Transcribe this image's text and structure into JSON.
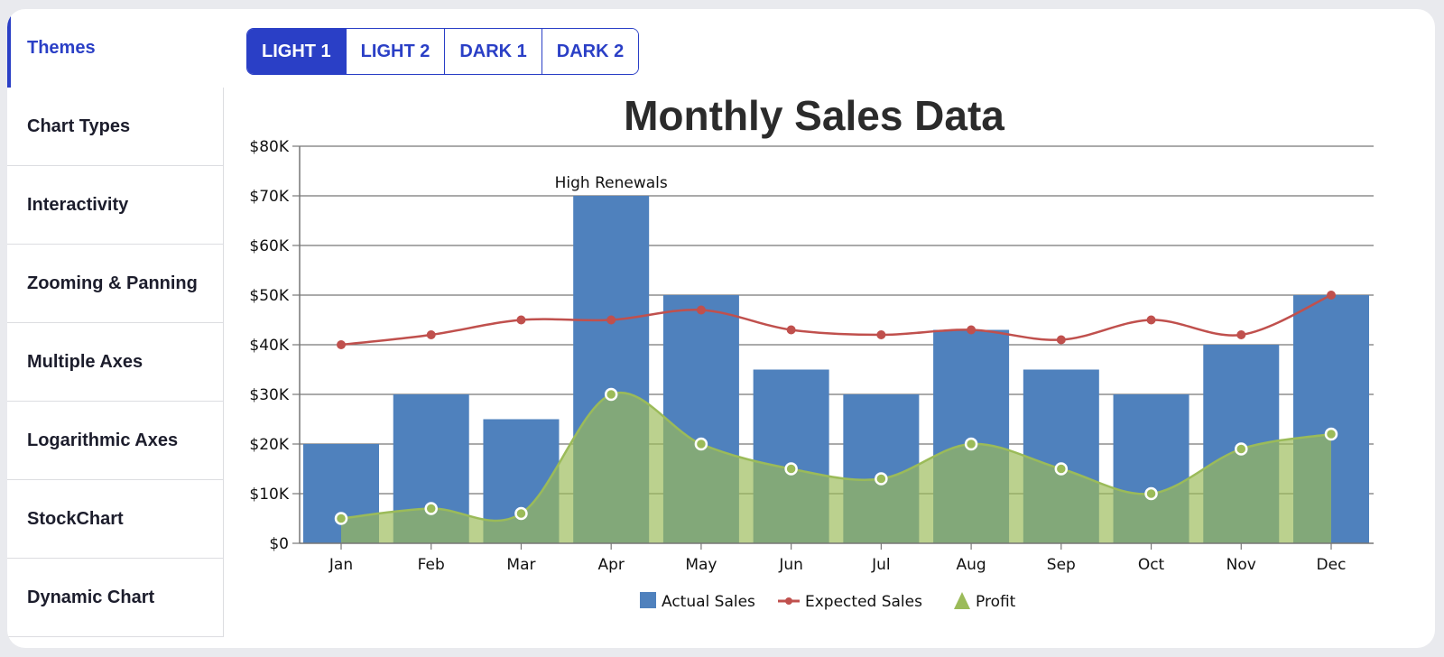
{
  "sidebar": {
    "items": [
      {
        "label": "Themes",
        "active": true
      },
      {
        "label": "Chart Types"
      },
      {
        "label": "Interactivity"
      },
      {
        "label": "Zooming & Panning"
      },
      {
        "label": "Multiple Axes"
      },
      {
        "label": "Logarithmic Axes"
      },
      {
        "label": "StockChart"
      },
      {
        "label": "Dynamic Chart"
      }
    ]
  },
  "themes": {
    "options": [
      "LIGHT 1",
      "LIGHT 2",
      "DARK 1",
      "DARK 2"
    ],
    "selected": "LIGHT 1"
  },
  "colors": {
    "accent": "#2a3fc6",
    "actual_sales": "#4f81bd",
    "expected_sales": "#c0504d",
    "profit_line": "#9bbb59",
    "profit_fill": "#86a96e"
  },
  "chart_data": {
    "type": "bar",
    "title": "Monthly Sales Data",
    "xlabel": "",
    "ylabel": "",
    "ylim": [
      0,
      80000
    ],
    "yticks": [
      0,
      10000,
      20000,
      30000,
      40000,
      50000,
      60000,
      70000,
      80000
    ],
    "ytick_labels": [
      "$0",
      "$10K",
      "$20K",
      "$30K",
      "$40K",
      "$50K",
      "$60K",
      "$70K",
      "$80K"
    ],
    "grid": true,
    "categories": [
      "Jan",
      "Feb",
      "Mar",
      "Apr",
      "May",
      "Jun",
      "Jul",
      "Aug",
      "Sep",
      "Oct",
      "Nov",
      "Dec"
    ],
    "series": [
      {
        "name": "Actual Sales",
        "type": "column",
        "values": [
          20000,
          30000,
          25000,
          70000,
          50000,
          35000,
          30000,
          43000,
          35000,
          30000,
          40000,
          50000
        ]
      },
      {
        "name": "Expected Sales",
        "type": "spline",
        "values": [
          40000,
          42000,
          45000,
          45000,
          47000,
          43000,
          42000,
          43000,
          41000,
          45000,
          42000,
          50000
        ]
      },
      {
        "name": "Profit",
        "type": "splineArea",
        "values": [
          5000,
          7000,
          6000,
          30000,
          20000,
          15000,
          13000,
          20000,
          15000,
          10000,
          19000,
          22000
        ]
      }
    ],
    "annotations": [
      {
        "category": "Apr",
        "series": "Actual Sales",
        "text": "High Renewals"
      }
    ],
    "legend": {
      "position": "bottom",
      "entries": [
        "Actual Sales",
        "Expected Sales",
        "Profit"
      ]
    }
  }
}
